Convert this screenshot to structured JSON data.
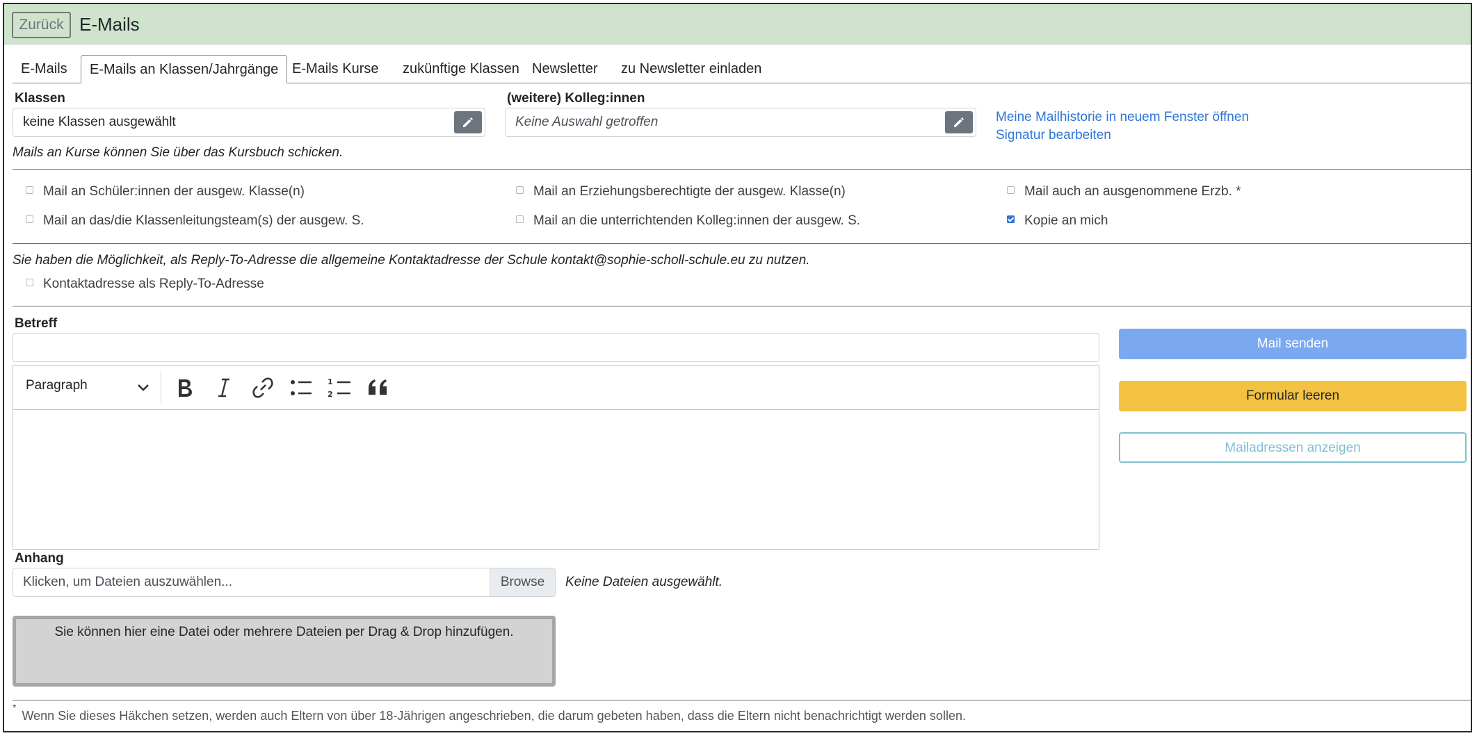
{
  "header": {
    "back_label": "Zurück",
    "title": "E-Mails"
  },
  "tabs": [
    {
      "label": "E-Mails",
      "active": false
    },
    {
      "label": "E-Mails an Klassen/Jahrgänge",
      "active": true
    },
    {
      "label": "E-Mails Kurse",
      "active": false
    },
    {
      "label": "zukünftige Klassen",
      "active": false
    },
    {
      "label": "Newsletter",
      "active": false
    },
    {
      "label": "zu Newsletter einladen",
      "active": false
    }
  ],
  "klassen": {
    "label": "Klassen",
    "value": "keine Klassen ausgewählt"
  },
  "kollegen": {
    "label": "(weitere) Kolleg:innen",
    "placeholder": "Keine Auswahl getroffen"
  },
  "links": {
    "history": "Meine Mailhistorie in neuem Fenster öffnen",
    "signature": "Signatur bearbeiten"
  },
  "kurse_note": "Mails an Kurse können Sie über das Kursbuch schicken.",
  "checkboxes": [
    {
      "label": "Mail an Schüler:innen der ausgew. Klasse(n)",
      "checked": false
    },
    {
      "label": "Mail an Erziehungsberechtigte der ausgew. Klasse(n)",
      "checked": false
    },
    {
      "label": "Mail auch an ausgenommene Erzb. *",
      "checked": false
    },
    {
      "label": "Mail an das/die Klassenleitungsteam(s) der ausgew. S.",
      "checked": false
    },
    {
      "label": "Mail an die unterrichtenden Kolleg:innen der ausgew. S.",
      "checked": false
    },
    {
      "label": "Kopie an mich",
      "checked": true
    }
  ],
  "reply_note": "Sie haben die Möglichkeit, als Reply-To-Adresse die allgemeine Kontaktadresse der Schule kontakt@sophie-scholl-schule.eu zu nutzen.",
  "reply_checkbox": {
    "label": "Kontaktadresse als Reply-To-Adresse",
    "checked": false
  },
  "betreff": {
    "label": "Betreff",
    "value": ""
  },
  "editor": {
    "paragraph_label": "Paragraph",
    "tools": [
      "bold-icon",
      "italic-icon",
      "link-icon",
      "bulleted-list-icon",
      "numbered-list-icon",
      "blockquote-icon"
    ]
  },
  "buttons": {
    "send": "Mail senden",
    "clear": "Formular leeren",
    "show_addresses": "Mailadressen anzeigen"
  },
  "anhang": {
    "label": "Anhang",
    "placeholder": "Klicken, um Dateien auszuwählen...",
    "browse": "Browse",
    "status": "Keine Dateien ausgewählt.",
    "dropzone": "Sie können hier eine Datei oder mehrere Dateien per Drag & Drop hinzufügen."
  },
  "footnote": {
    "mark": "*",
    "text": "Wenn Sie dieses Häkchen setzen, werden auch Eltern von über 18-Jährigen angeschrieben, die darum gebeten haben, dass die Eltern nicht benachrichtigt werden sollen."
  },
  "colors": {
    "header_bg": "#d0e4cd",
    "link": "#2f75d6",
    "send": "#7aa9f2",
    "clear": "#f4c241",
    "addr": "#7fc0cf"
  }
}
